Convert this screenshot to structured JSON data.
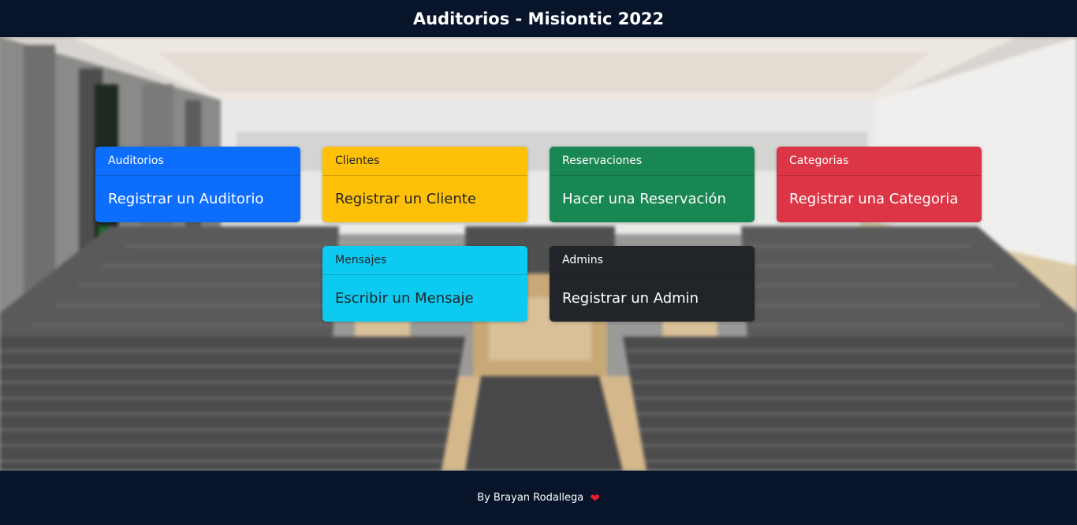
{
  "header": {
    "title": "Auditorios - Misiontic 2022"
  },
  "cards": [
    {
      "header": "Auditorios",
      "body": "Registrar un Auditorio",
      "color": "#0d6efd"
    },
    {
      "header": "Clientes",
      "body": "Registrar un Cliente",
      "color": "#ffc107"
    },
    {
      "header": "Reservaciones",
      "body": "Hacer una Reservación",
      "color": "#198754"
    },
    {
      "header": "Categorias",
      "body": "Registrar una Categoria",
      "color": "#dc3545"
    },
    {
      "header": "Mensajes",
      "body": "Escribir un Mensaje",
      "color": "#0dcaf0"
    },
    {
      "header": "Admins",
      "body": "Registrar un Admin",
      "color": "#212529"
    }
  ],
  "footer": {
    "text": "By Brayan Rodallega",
    "icon": "heart-icon"
  },
  "colors": {
    "navbar": "#08142a",
    "heart": "#e11d2e"
  }
}
